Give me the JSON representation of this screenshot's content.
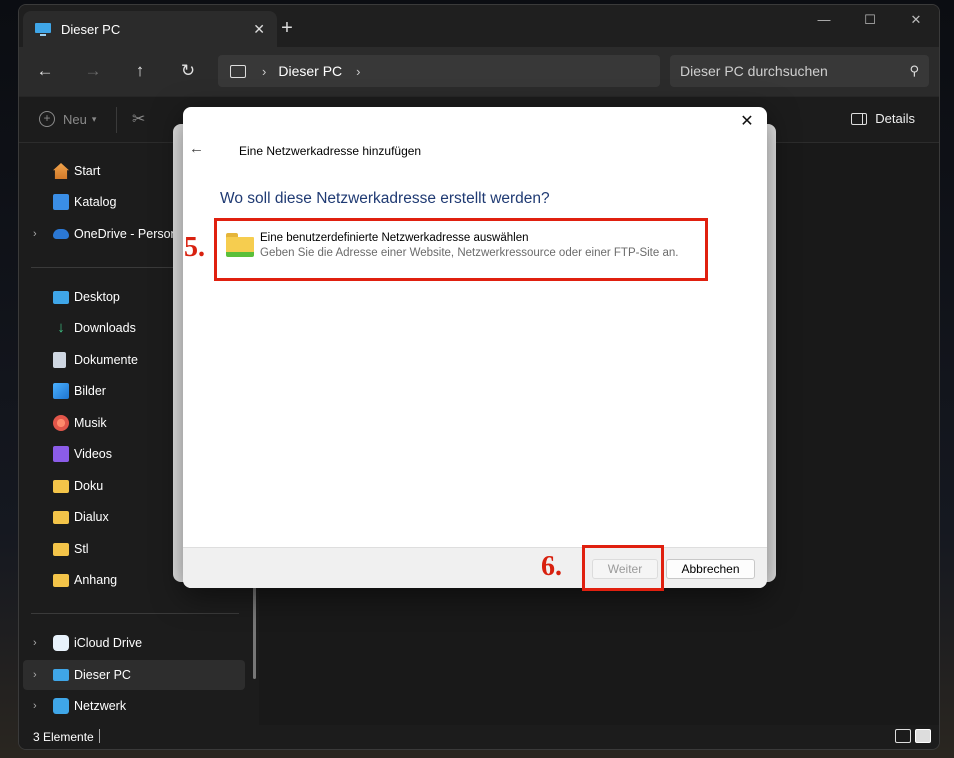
{
  "window": {
    "tab_title": "Dieser PC",
    "new_tab_icon": "+",
    "controls": [
      "—",
      "☐",
      "✕"
    ]
  },
  "navbar": {
    "address": "Dieser PC",
    "search_placeholder": "Dieser PC durchsuchen"
  },
  "commandbar": {
    "new_label": "Neu",
    "details_label": "Details"
  },
  "sidebar": {
    "items": [
      {
        "label": "Start",
        "icon": "home-icon"
      },
      {
        "label": "Katalog",
        "icon": "gallery-icon"
      },
      {
        "label": "OneDrive - Persona",
        "icon": "onedrive-icon"
      },
      {
        "label": "Desktop",
        "icon": "desktop-icon"
      },
      {
        "label": "Downloads",
        "icon": "download-icon"
      },
      {
        "label": "Dokumente",
        "icon": "document-icon"
      },
      {
        "label": "Bilder",
        "icon": "pictures-icon"
      },
      {
        "label": "Musik",
        "icon": "music-icon"
      },
      {
        "label": "Videos",
        "icon": "video-icon"
      },
      {
        "label": "Doku",
        "icon": "folder-icon"
      },
      {
        "label": "Dialux",
        "icon": "folder-icon"
      },
      {
        "label": "Stl",
        "icon": "folder-icon"
      },
      {
        "label": "Anhang",
        "icon": "folder-icon"
      },
      {
        "label": "iCloud Drive",
        "icon": "icloud-icon"
      },
      {
        "label": "Dieser PC",
        "icon": "pc-icon"
      },
      {
        "label": "Netzwerk",
        "icon": "network-icon"
      }
    ]
  },
  "statusbar": {
    "count": "3 Elemente"
  },
  "dialog": {
    "title": "Eine Netzwerkadresse hinzufügen",
    "heading": "Wo soll diese Netzwerkadresse erstellt werden?",
    "option_title": "Eine benutzerdefinierte Netzwerkadresse auswählen",
    "option_desc": "Geben Sie die Adresse einer Website, Netzwerkressource oder einer FTP-Site an.",
    "next_label": "Weiter",
    "cancel_label": "Abbrechen"
  },
  "annotations": {
    "step5": "5.",
    "step6": "6.",
    "color": "#e0200f"
  }
}
